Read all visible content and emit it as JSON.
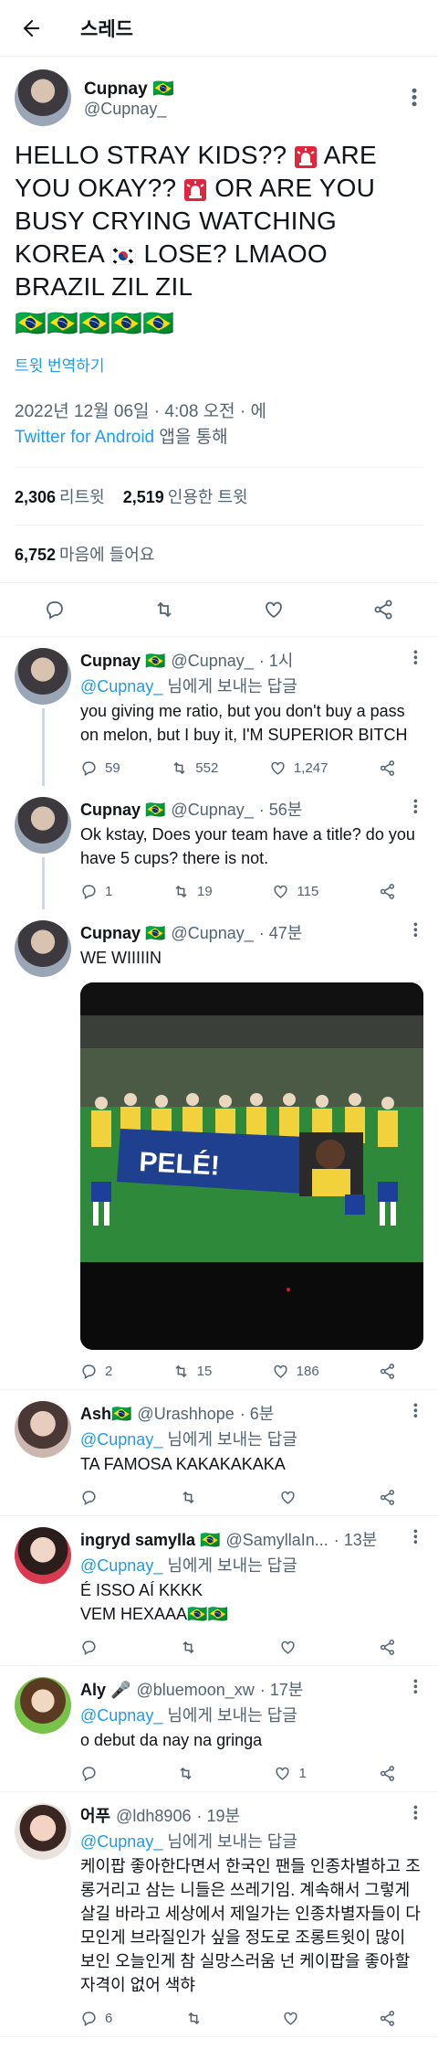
{
  "header": {
    "title": "스레드"
  },
  "main_tweet": {
    "display_name": "Cupnay 🇧🇷",
    "handle": "@Cupnay_",
    "text_part1": "HELLO STRAY KIDS?? ",
    "text_part2": " ARE YOU OKAY?? ",
    "text_part3": " OR ARE YOU BUSY CRYING WATCHING KOREA ",
    "text_part4": " LOSE? LMAOO BRAZIL ZIL ZIL",
    "trailing_flags": "🇧🇷🇧🇷🇧🇷🇧🇷🇧🇷",
    "translate": "트윗 번역하기",
    "timestamp": "2022년 12월 06일 · 4:08 오전 · 에",
    "source": "Twitter for Android",
    "source_suffix": " 앱을 통해",
    "retweets_count": "2,306",
    "retweets_label": "리트윗",
    "quotes_count": "2,519",
    "quotes_label": "인용한 트윗",
    "likes_count": "6,752",
    "likes_label": "마음에 들어요"
  },
  "replies": [
    {
      "display_name": "Cupnay 🇧🇷",
      "handle": "@Cupnay_",
      "time": "· 1시",
      "reply_to_mention": "@Cupnay_",
      "reply_to_suffix": " 님에게 보내는 답글",
      "text": "you giving me ratio, but you don't buy a pass on melon, but I buy it, I'M SUPERIOR BITCH",
      "reply_count": "59",
      "retweet_count": "552",
      "like_count": "1,247"
    },
    {
      "display_name": "Cupnay 🇧🇷",
      "handle": "@Cupnay_",
      "time": "· 56분",
      "text": "Ok kstay, Does your team have a title? do you have 5 cups? there is not.",
      "reply_count": "1",
      "retweet_count": "19",
      "like_count": "115"
    },
    {
      "display_name": "Cupnay 🇧🇷",
      "handle": "@Cupnay_",
      "time": "· 47분",
      "text": "WE WIIIIIN",
      "banner_text": "PELÉ!",
      "reply_count": "2",
      "retweet_count": "15",
      "like_count": "186"
    },
    {
      "display_name": "Ash🇧🇷",
      "handle": "@Urashhope",
      "time": "· 6분",
      "reply_to_mention": "@Cupnay_",
      "reply_to_suffix": " 님에게 보내는 답글",
      "text": "TA FAMOSA KAKAKAKAKA",
      "reply_count": "",
      "retweet_count": "",
      "like_count": ""
    },
    {
      "display_name": "ingryd samylla 🇧🇷",
      "handle": "@SamyllaIn...",
      "time": "· 13분",
      "reply_to_mention": "@Cupnay_",
      "reply_to_suffix": " 님에게 보내는 답글",
      "text": "É ISSO AÍ KKKK\nVEM HEXAAA🇧🇷🇧🇷",
      "reply_count": "",
      "retweet_count": "",
      "like_count": ""
    },
    {
      "display_name": "Aly 🎤",
      "handle": "@bluemoon_xw",
      "time": "· 17분",
      "reply_to_mention": "@Cupnay_",
      "reply_to_suffix": " 님에게 보내는 답글",
      "text": "o debut da nay na gringa",
      "reply_count": "",
      "retweet_count": "",
      "like_count": "1"
    },
    {
      "display_name": "어푸",
      "handle": "@ldh8906",
      "time": "· 19분",
      "reply_to_mention": "@Cupnay_",
      "reply_to_suffix": " 님에게 보내는 답글",
      "text": "케이팝 좋아한다면서 한국인 팬들 인종차별하고 조롱거리고 삼는 니들은 쓰레기임. 계속해서 그렇게 살길 바라고 세상에서 제일가는 인종차별자들이 다 모인게 브라질인가 싶을 정도로 조롱트윗이 많이 보인 오늘인게 참 실망스러움 넌 케이팝을 좋아할 자격이 없어 색햐",
      "reply_count": "6",
      "retweet_count": "",
      "like_count": ""
    }
  ],
  "icons": {
    "back": "arrow-left-icon",
    "more": "more-icon",
    "reply": "reply-icon",
    "retweet": "retweet-icon",
    "like": "heart-icon",
    "share": "share-icon",
    "alarm": "police-light-icon",
    "flag_br": "brazil-flag-icon",
    "flag_kr": "korea-flag-icon"
  },
  "colors": {
    "accent": "#1d9bf0",
    "secondary_text": "#536471",
    "divider": "#eff3f4"
  }
}
